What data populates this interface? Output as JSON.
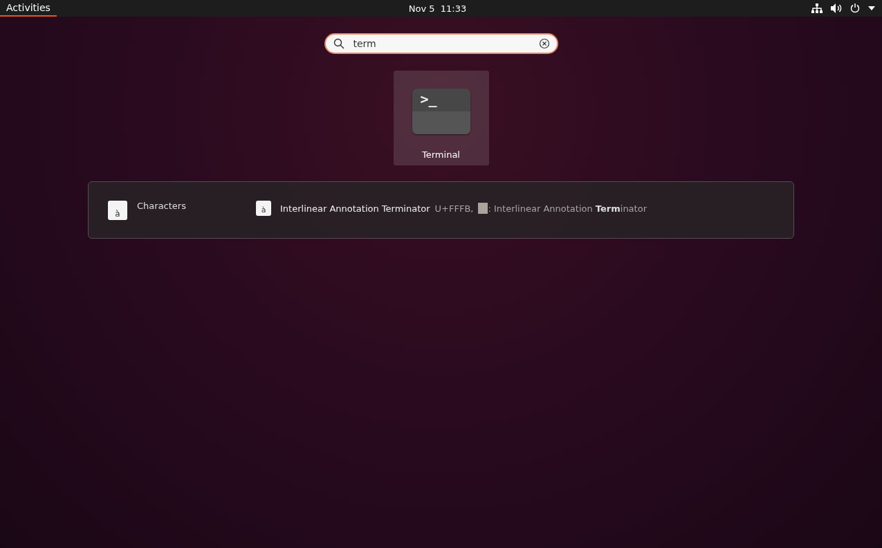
{
  "top_bar": {
    "activities": {
      "label": "Activities",
      "selected": true
    },
    "clock": "Nov 5  11:33"
  },
  "search": {
    "value": "term"
  },
  "app_results": [
    {
      "name": "Terminal",
      "icon_text": ">_",
      "selected": true
    }
  ],
  "provider_results": [
    {
      "provider": "Characters",
      "provider_icon_text": "à",
      "items": [
        {
          "icon_text": "à",
          "title": "Interlinear Annotation Terminator",
          "description_prefix": "U+FFFB,",
          "description_rest": ": Interlinear Annotation **Term**inator"
        }
      ]
    }
  ]
}
